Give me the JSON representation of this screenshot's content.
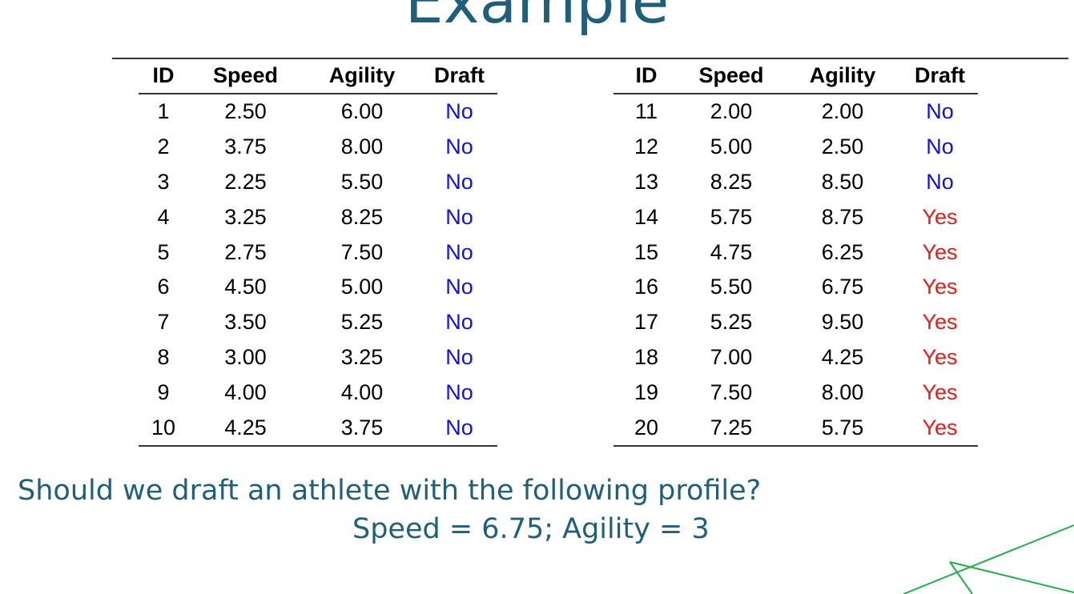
{
  "slide": {
    "title": "Example",
    "question": "Should we draft an athlete with the following profile?",
    "profile": "Speed = 6.75;  Agility = 3"
  },
  "table": {
    "columns": [
      "ID",
      "Speed",
      "Agility",
      "Draft"
    ],
    "left_rows": [
      [
        "1",
        "2.50",
        "6.00",
        "No"
      ],
      [
        "2",
        "3.75",
        "8.00",
        "No"
      ],
      [
        "3",
        "2.25",
        "5.50",
        "No"
      ],
      [
        "4",
        "3.25",
        "8.25",
        "No"
      ],
      [
        "5",
        "2.75",
        "7.50",
        "No"
      ],
      [
        "6",
        "4.50",
        "5.00",
        "No"
      ],
      [
        "7",
        "3.50",
        "5.25",
        "No"
      ],
      [
        "8",
        "3.00",
        "3.25",
        "No"
      ],
      [
        "9",
        "4.00",
        "4.00",
        "No"
      ],
      [
        "10",
        "4.25",
        "3.75",
        "No"
      ]
    ],
    "right_rows": [
      [
        "11",
        "2.00",
        "2.00",
        "No"
      ],
      [
        "12",
        "5.00",
        "2.50",
        "No"
      ],
      [
        "13",
        "8.25",
        "8.50",
        "No"
      ],
      [
        "14",
        "5.75",
        "8.75",
        "Yes"
      ],
      [
        "15",
        "4.75",
        "6.25",
        "Yes"
      ],
      [
        "16",
        "5.50",
        "6.75",
        "Yes"
      ],
      [
        "17",
        "5.25",
        "9.50",
        "Yes"
      ],
      [
        "18",
        "7.00",
        "4.25",
        "Yes"
      ],
      [
        "19",
        "7.50",
        "8.00",
        "Yes"
      ],
      [
        "20",
        "7.25",
        "5.75",
        "Yes"
      ]
    ]
  },
  "colors": {
    "title": "#1f5f7a",
    "draft_no": "#1010e6",
    "draft_yes": "#e51b1b",
    "decor_lines": "#22b04b"
  }
}
